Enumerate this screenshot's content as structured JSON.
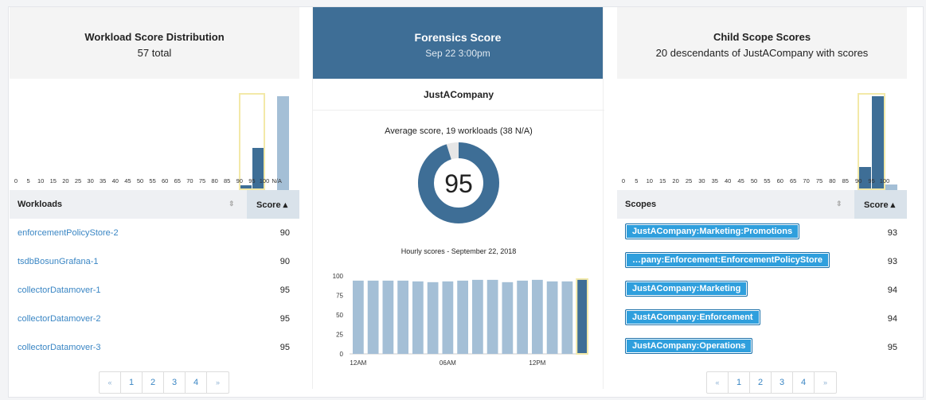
{
  "left": {
    "title": "Workload Score Distribution",
    "subtitle": "57 total",
    "ticks": [
      "0",
      "5",
      "10",
      "15",
      "20",
      "25",
      "30",
      "35",
      "40",
      "45",
      "50",
      "55",
      "60",
      "65",
      "70",
      "75",
      "80",
      "85",
      "90",
      "95",
      "100",
      "N/A"
    ],
    "chart_data": {
      "type": "bar",
      "categories": [
        "90",
        "95",
        "N/A"
      ],
      "values": [
        2,
        17,
        38
      ],
      "highlight": [
        "90",
        "95"
      ]
    },
    "table": {
      "col1": "Workloads",
      "col2": "Score",
      "rows": [
        {
          "name": "enforcementPolicyStore-2",
          "score": "90"
        },
        {
          "name": "tsdbBosunGrafana-1",
          "score": "90"
        },
        {
          "name": "collectorDatamover-1",
          "score": "95"
        },
        {
          "name": "collectorDatamover-2",
          "score": "95"
        },
        {
          "name": "collectorDatamover-3",
          "score": "95"
        }
      ]
    },
    "pager": [
      "«",
      "1",
      "2",
      "3",
      "4",
      "»"
    ]
  },
  "center": {
    "title": "Forensics Score",
    "subtitle": "Sep 22 3:00pm",
    "company": "JustACompany",
    "avg_label": "Average score, 19 workloads (38 N/A)",
    "score": "95",
    "score_fraction": 0.95,
    "hourly_title": "Hourly scores - September 22, 2018",
    "chart_data": {
      "type": "bar",
      "yticks": [
        "100",
        "75",
        "50",
        "25",
        "0"
      ],
      "xlabels": [
        "12AM",
        "06AM",
        "12PM"
      ],
      "values": [
        94,
        94,
        94,
        94,
        93,
        92,
        93,
        94,
        95,
        95,
        92,
        94,
        95,
        93,
        93,
        96
      ],
      "ylim": [
        0,
        100
      ]
    },
    "colors": {
      "header": "#3e6e96",
      "bar": "#a4bfd6",
      "bar_highlight": "#3e6e96"
    }
  },
  "right": {
    "title": "Child Scope Scores",
    "subtitle": "20 descendants of JustACompany with scores",
    "ticks": [
      "0",
      "5",
      "10",
      "15",
      "20",
      "25",
      "30",
      "35",
      "40",
      "45",
      "50",
      "55",
      "60",
      "65",
      "70",
      "75",
      "80",
      "85",
      "90",
      "95",
      "100"
    ],
    "chart_data": {
      "type": "bar",
      "categories": [
        "90",
        "95",
        "100"
      ],
      "values": [
        4,
        16,
        1
      ],
      "highlight": [
        "90",
        "95"
      ]
    },
    "table": {
      "col1": "Scopes",
      "col2": "Score",
      "rows": [
        {
          "name": "JustACompany:Marketing:Promotions",
          "score": "93"
        },
        {
          "name": "…pany:Enforcement:EnforcementPolicyStore",
          "score": "93"
        },
        {
          "name": "JustACompany:Marketing",
          "score": "94"
        },
        {
          "name": "JustACompany:Enforcement",
          "score": "94"
        },
        {
          "name": "JustACompany:Operations",
          "score": "95"
        }
      ]
    },
    "pager": [
      "«",
      "1",
      "2",
      "3",
      "4",
      "»"
    ]
  }
}
